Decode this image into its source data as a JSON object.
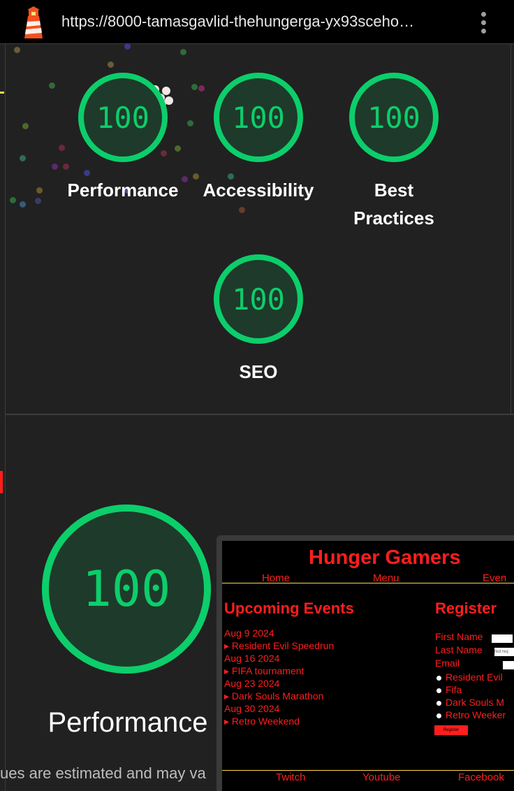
{
  "browser": {
    "url": "https://8000-tamasgavlid-thehungerga-yx93sceho…",
    "app_icon": "lighthouse-icon",
    "menu_icon": "kebab-menu-icon"
  },
  "scores": [
    {
      "label": "Performance",
      "value": "100"
    },
    {
      "label": "Accessibility",
      "value": "100"
    },
    {
      "label": "Best Practices",
      "value": "100"
    },
    {
      "label": "SEO",
      "value": "100"
    }
  ],
  "performance_section": {
    "score": "100",
    "title": "Performance",
    "note": "ues are estimated and may va"
  },
  "colors": {
    "pass": "#0cce6b",
    "background": "#212121",
    "site_red": "#ff1e1e"
  },
  "screenshot": {
    "site_title": "Hunger Gamers",
    "nav": [
      "Home",
      "Menu",
      "Even"
    ],
    "events_heading": "Upcoming Events",
    "events": [
      {
        "date": "Aug 9 2024",
        "name": "Resident Evil Speedrun"
      },
      {
        "date": "Aug 16 2024",
        "name": "FIFA tournament"
      },
      {
        "date": "Aug 23 2024",
        "name": "Dark Souls Marathon"
      },
      {
        "date": "Aug 30 2024",
        "name": "Retro Weekend"
      }
    ],
    "register_heading": "Register",
    "form": {
      "first_name": "First Name",
      "last_name": "Last Name",
      "last_name_placeholder": "Not req",
      "email": "Email"
    },
    "options": [
      "Resident Evil",
      "Fifa",
      "Dark Souls M",
      "Retro Weeker"
    ],
    "register_button": "Register",
    "footer": [
      "Twitch",
      "Youtube",
      "Facebook"
    ]
  }
}
